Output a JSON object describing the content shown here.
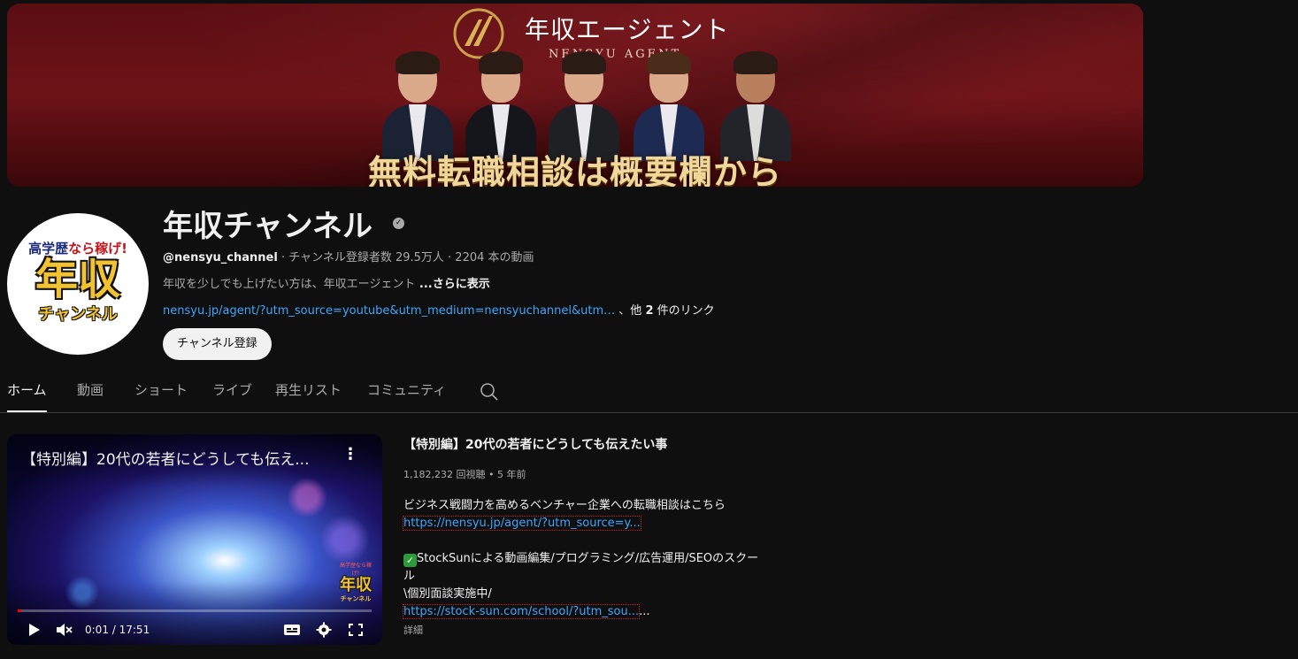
{
  "banner": {
    "brand_jp": "年収エージェント",
    "brand_en": "NENSYU AGENT",
    "cta": "無料転職相談は概要欄から"
  },
  "avatar": {
    "top_line_a": "高学歴",
    "top_line_b": "なら稼げ!",
    "main": "年収",
    "sub": "チャンネル"
  },
  "channel": {
    "title": "年収チャンネル",
    "handle": "@nensyu_channel",
    "stats": " · チャンネル登録者数 29.5万人 · 2204 本の動画",
    "description": "年収を少しでも上げたい方は、年収エージェント",
    "description_more": " ...さらに表示",
    "link_url": "nensyu.jp/agent/?utm_source=youtube&utm_medium=nensyuchannel&utm…",
    "link_more_prefix": " 、他 ",
    "link_more_count": "2",
    "link_more_suffix": " 件のリンク",
    "subscribe_label": "チャンネル登録"
  },
  "tabs": [
    {
      "label": "ホーム"
    },
    {
      "label": "動画"
    },
    {
      "label": "ショート"
    },
    {
      "label": "ライブ"
    },
    {
      "label": "再生リスト"
    },
    {
      "label": "コミュニティ"
    }
  ],
  "player": {
    "title": "【特別編】20代の若者にどうしても伝え...",
    "menu_icon": "more-vert-icon",
    "logo_top": "高学歴なら稼げ!",
    "logo_main": "年収",
    "logo_sub": "チャンネル",
    "progress": 0.01,
    "time": "0:01 / 17:51"
  },
  "video": {
    "title": "【特別編】20代の若者にどうしても伝えたい事",
    "meta": "1,182,232 回視聴 • 5 年前",
    "desc_line1": "ビジネス戦闘力を高めるベンチャー企業への転職相談はこちら",
    "desc_link1": "https://nensyu.jp/agent/?utm_source=y...",
    "desc_line2": "StockSunによる動画編集/プログラミング/広告運用/SEOのスクール",
    "desc_line3": "\\個別面談実施中/",
    "desc_link2": "https://stock-sun.com/school/?utm_sou...",
    "desc_ellipsis": "...",
    "more": "詳細"
  }
}
